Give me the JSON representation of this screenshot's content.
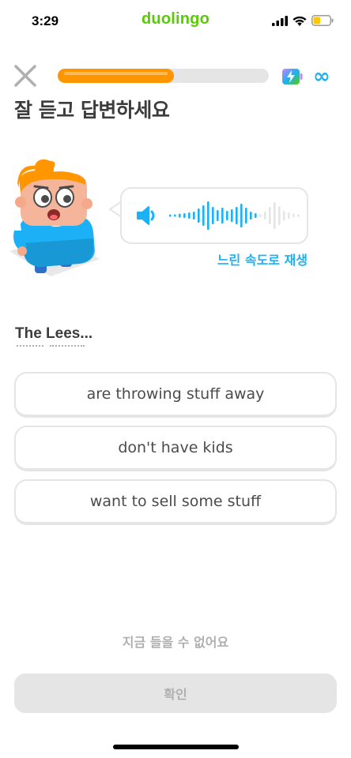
{
  "status_bar": {
    "time": "3:29",
    "brand": "duolingo",
    "icons": [
      "signal-icon",
      "wifi-icon",
      "battery-icon"
    ]
  },
  "header": {
    "close_icon": "close-icon",
    "progress": 0.55,
    "energy_icon": "energy-battery-icon",
    "energy_value": "∞"
  },
  "title": "잘 듣고 답변하세요",
  "audio": {
    "play_icon": "speaker-icon",
    "slow_label": "느린 속도로 재생"
  },
  "prompt": "The Lees...",
  "options": [
    "are throwing stuff away",
    "don't have kids",
    "want to sell some stuff"
  ],
  "footer": {
    "cant_listen": "지금 들을 수 없어요",
    "check": "확인"
  },
  "colors": {
    "brand_green": "#58cc02",
    "progress_orange": "#ff9600",
    "accent_blue": "#1cb0f6",
    "border_gray": "#e5e5e5",
    "muted_text": "#afafaf"
  }
}
